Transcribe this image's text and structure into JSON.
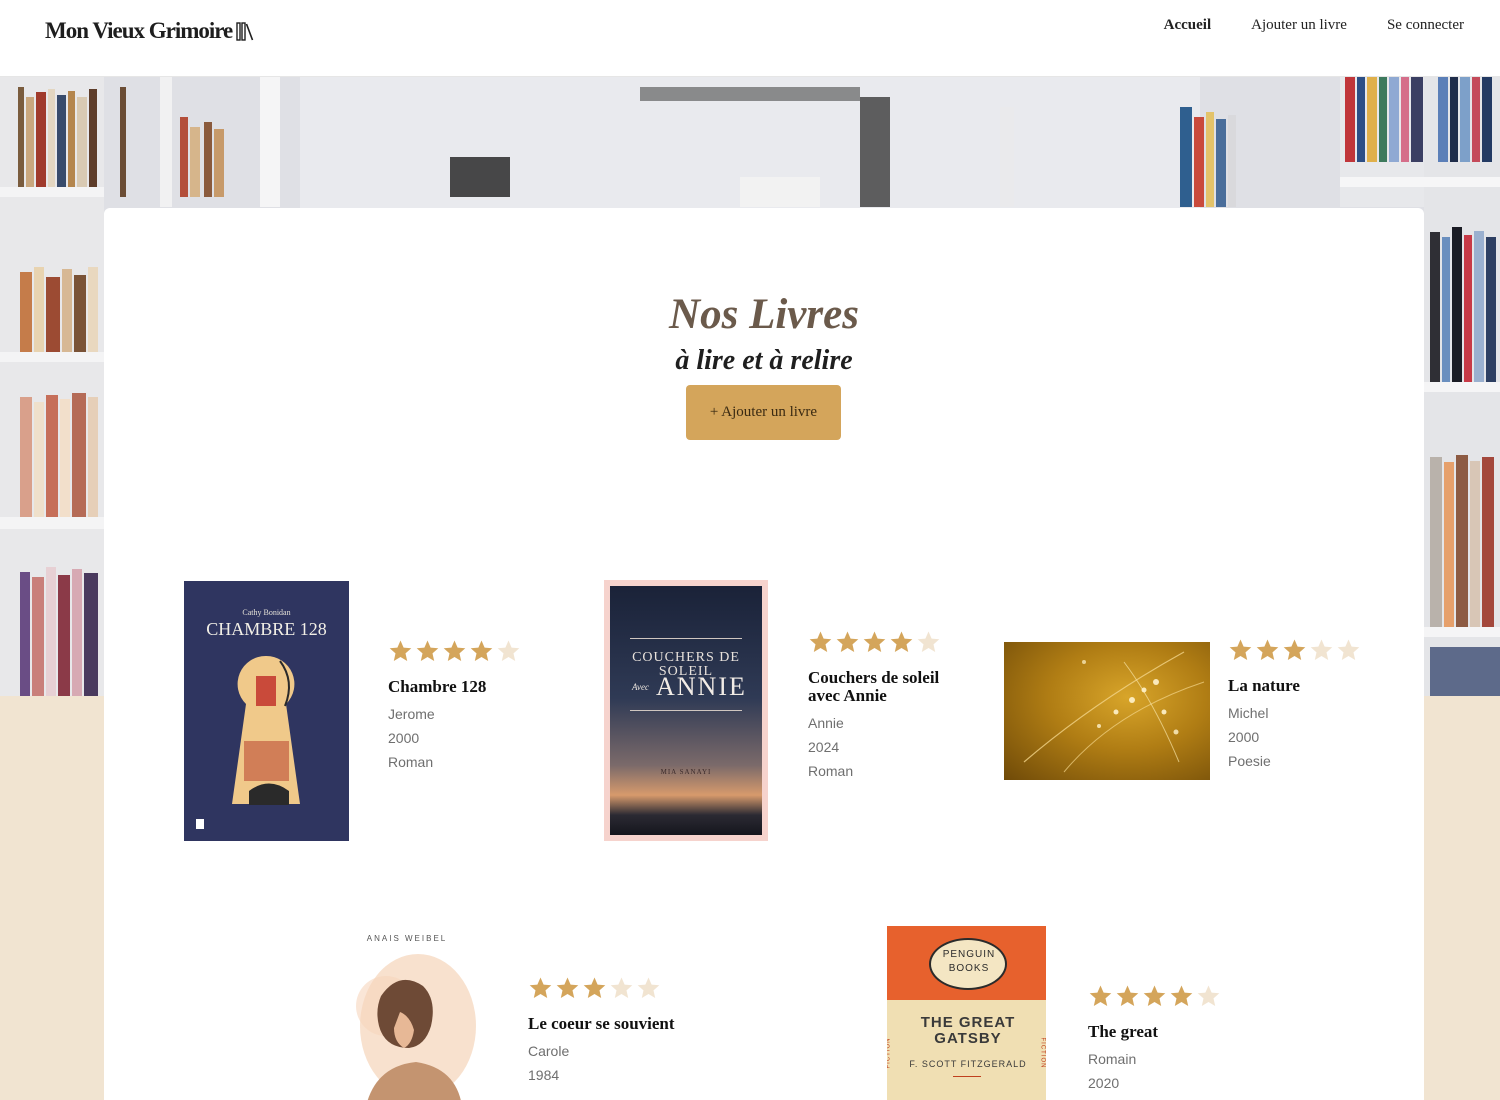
{
  "app": {
    "logo_text": "Mon Vieux Grimoire"
  },
  "nav": {
    "items": [
      {
        "label": "Accueil",
        "active": true
      },
      {
        "label": "Ajouter un livre",
        "active": false
      },
      {
        "label": "Se connecter",
        "active": false
      }
    ]
  },
  "main": {
    "title": "Nos Livres",
    "subtitle": "à lire et à relire",
    "add_button": "+ Ajouter un livre"
  },
  "colors": {
    "accent": "#d4a55b",
    "star_filled": "#d4a55b",
    "star_empty": "#f1e4d1",
    "background_lower": "#f1e4d1"
  },
  "books": [
    {
      "title": "Chambre 128",
      "author": "Jerome",
      "year": "2000",
      "genre": "Roman",
      "rating": 4,
      "cover": {
        "kind": "chambre",
        "small_text": "Cathy Bonidan",
        "big_text": "CHAMBRE 128"
      }
    },
    {
      "title": "Couchers de soleil avec Annie",
      "author": "Annie",
      "year": "2024",
      "genre": "Roman",
      "rating": 4,
      "cover": {
        "kind": "sunset",
        "line1": "COUCHERS DE",
        "line2": "SOLEIL",
        "line3_small": "Avec",
        "line3_big": "ANNIE",
        "author_text": "MIA SANAYI"
      }
    },
    {
      "title": "La nature",
      "author": "Michel",
      "year": "2000",
      "genre": "Poesie",
      "rating": 3,
      "cover": {
        "kind": "nature"
      }
    },
    {
      "title": "Le coeur se souvient",
      "author": "Carole",
      "year": "1984",
      "genre": "",
      "rating": 3,
      "cover": {
        "kind": "coeur",
        "top_text": "ANAIS WEIBEL"
      }
    },
    {
      "title": "The great",
      "author": "Romain",
      "year": "2020",
      "genre": "",
      "rating": 4,
      "cover": {
        "kind": "gatsby",
        "badge_line1": "PENGUIN",
        "badge_line2": "BOOKS",
        "title_line1": "THE GREAT",
        "title_line2": "GATSBY",
        "author_text": "F. SCOTT FITZGERALD",
        "side_text": "FICTION"
      }
    }
  ]
}
